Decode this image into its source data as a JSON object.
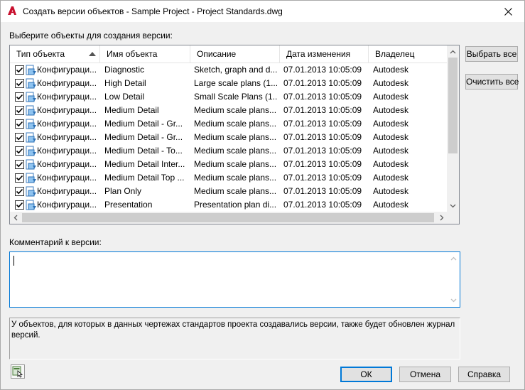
{
  "window": {
    "title": "Создать версии объектов - Sample Project - Project Standards.dwg"
  },
  "list": {
    "label": "Выберите объекты для создания версии:",
    "columns": [
      "Тип объекта",
      "Имя объекта",
      "Описание",
      "Дата изменения",
      "Владелец"
    ],
    "sort_column": "Тип объекта",
    "rows": [
      {
        "type": "Конфигураци...",
        "name": "Diagnostic",
        "desc": "Sketch, graph and d...",
        "date": "07.01.2013 10:05:09",
        "owner": "Autodesk",
        "checked": true
      },
      {
        "type": "Конфигураци...",
        "name": "High Detail",
        "desc": "Large scale plans (1...",
        "date": "07.01.2013 10:05:09",
        "owner": "Autodesk",
        "checked": true
      },
      {
        "type": "Конфигураци...",
        "name": "Low Detail",
        "desc": "Small Scale Plans (1...",
        "date": "07.01.2013 10:05:09",
        "owner": "Autodesk",
        "checked": true
      },
      {
        "type": "Конфигураци...",
        "name": "Medium Detail",
        "desc": "Medium scale plans...",
        "date": "07.01.2013 10:05:09",
        "owner": "Autodesk",
        "checked": true
      },
      {
        "type": "Конфигураци...",
        "name": "Medium Detail - Gr...",
        "desc": "Medium scale plans...",
        "date": "07.01.2013 10:05:09",
        "owner": "Autodesk",
        "checked": true
      },
      {
        "type": "Конфигураци...",
        "name": "Medium Detail - Gr...",
        "desc": "Medium scale plans...",
        "date": "07.01.2013 10:05:09",
        "owner": "Autodesk",
        "checked": true
      },
      {
        "type": "Конфигураци...",
        "name": "Medium Detail - To...",
        "desc": "Medium scale plans...",
        "date": "07.01.2013 10:05:09",
        "owner": "Autodesk",
        "checked": true
      },
      {
        "type": "Конфигураци...",
        "name": "Medium Detail Inter...",
        "desc": "Medium scale plans...",
        "date": "07.01.2013 10:05:09",
        "owner": "Autodesk",
        "checked": true
      },
      {
        "type": "Конфигураци...",
        "name": "Medium Detail Top ...",
        "desc": "Medium scale plans...",
        "date": "07.01.2013 10:05:09",
        "owner": "Autodesk",
        "checked": true
      },
      {
        "type": "Конфигураци...",
        "name": "Plan Only",
        "desc": "Medium scale plans...",
        "date": "07.01.2013 10:05:09",
        "owner": "Autodesk",
        "checked": true
      },
      {
        "type": "Конфигураци...",
        "name": "Presentation",
        "desc": "Presentation plan di...",
        "date": "07.01.2013 10:05:09",
        "owner": "Autodesk",
        "checked": true
      }
    ]
  },
  "side_buttons": {
    "select_all": "Выбрать все",
    "clear_all": "Очистить все"
  },
  "comment": {
    "label": "Комментарий к версии:",
    "value": ""
  },
  "info": {
    "text": "У объектов, для которых в данных чертежах стандартов проекта создавались версии, также будет обновлен журнал версий."
  },
  "footer": {
    "ok": "ОК",
    "cancel": "Отмена",
    "help": "Справка"
  },
  "colors": {
    "accent": "#0078d7",
    "logo_red": "#c8102e"
  }
}
